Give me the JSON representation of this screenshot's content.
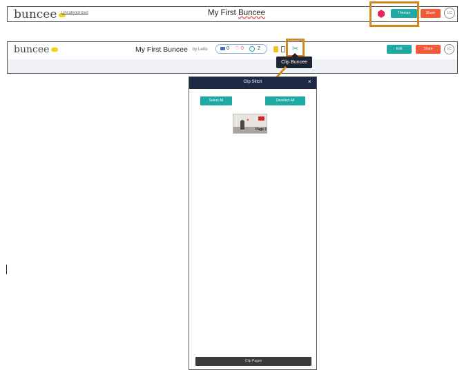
{
  "top_toolbar": {
    "logo": "buncee",
    "category": "Uncategorized",
    "title_prefix": "My First ",
    "title_underlined": "Buncee",
    "themes_label": "Themes",
    "share_label": "Share",
    "avatar_initials": "LC"
  },
  "second_toolbar": {
    "logo": "buncee",
    "title": "My First Buncee",
    "byline": "by Leilis",
    "comments": "0",
    "likes": "0",
    "remixes": "2",
    "edit_label": "Edit",
    "share_label": "Share",
    "avatar_initials": "LC"
  },
  "tooltip": {
    "text": "Clip Buncee"
  },
  "modal": {
    "title": "Clip Stitch",
    "close": "×",
    "select_all": "Select All",
    "deselect_all": "Deselect All",
    "page_label": "Page 1",
    "clip_pages": "Clip Pages"
  },
  "colors": {
    "teal": "#1fa9a4",
    "orange_share": "#f05a3a",
    "highlight": "#d5861f",
    "modal_header": "#1e2a45"
  },
  "icons": [
    "ruby-icon",
    "comment-icon",
    "heart-icon",
    "remix-icon",
    "coin-icon",
    "document-icon",
    "scissors-icon",
    "close-icon"
  ]
}
